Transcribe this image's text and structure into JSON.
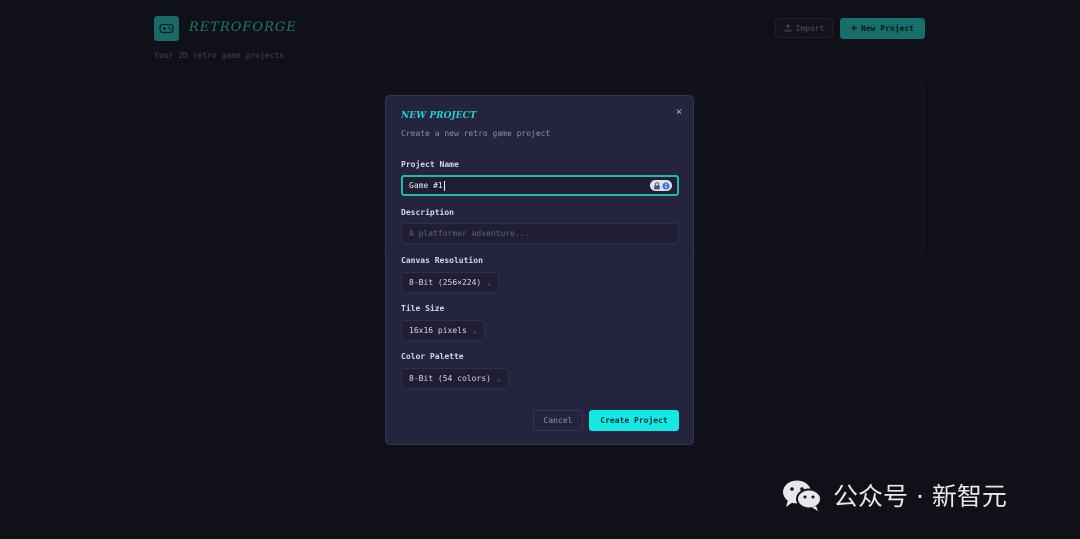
{
  "header": {
    "brand": "RETROFORGE",
    "subtitle": "Your 2D retro game projects",
    "import_label": "Import",
    "new_project_label": "New Project"
  },
  "modal": {
    "title": "NEW PROJECT",
    "description": "Create a new retro game project",
    "close_label": "×",
    "fields": {
      "project_name": {
        "label": "Project Name",
        "value": "Game #1"
      },
      "description": {
        "label": "Description",
        "placeholder": "A platformer adventure..."
      },
      "canvas_resolution": {
        "label": "Canvas Resolution",
        "selected": "8-Bit (256×224)"
      },
      "tile_size": {
        "label": "Tile Size",
        "selected": "16x16 pixels"
      },
      "color_palette": {
        "label": "Color Palette",
        "selected": "8-Bit (54 colors)"
      }
    },
    "cancel_label": "Cancel",
    "create_label": "Create Project"
  },
  "watermark": {
    "text": "公众号 · 新智元"
  },
  "colors": {
    "accent": "#1fa79f",
    "accent_bright": "#14e8e4",
    "modal_bg": "#25243f",
    "page_bg": "#15151f"
  },
  "icons": {
    "logo": "gamepad-icon",
    "import": "upload-icon",
    "new": "plus-icon",
    "close": "close-icon",
    "chevron": "chevron-down-icon",
    "password_manager": "password-manager-icon"
  }
}
